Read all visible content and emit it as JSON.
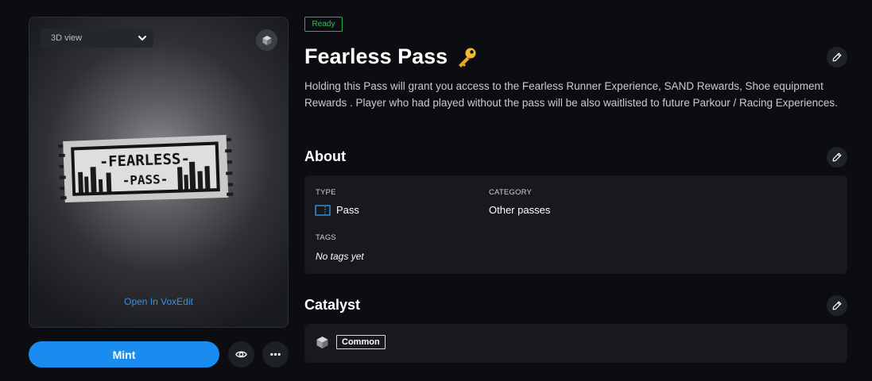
{
  "preview": {
    "view_select": {
      "value": "3D view",
      "icon": "chevron-down-icon"
    },
    "cube_icon": "cube-icon",
    "open_voxedit_label": "Open In VoxEdit",
    "ticket": {
      "line1": "-FEARLESS-",
      "line2": "-PASS-"
    }
  },
  "actions": {
    "mint_label": "Mint",
    "view_icon": "eye-icon",
    "more_icon": "more-icon"
  },
  "asset": {
    "status": "Ready",
    "title": "Fearless Pass",
    "title_icon": "key-icon",
    "description": "Holding this Pass will grant you access to the Fearless Runner Experience, SAND Rewards, Shoe equipment Rewards . Player who had played without the pass will be also waitlisted to future Parkour / Racing Experiences."
  },
  "about": {
    "heading": "About",
    "type_label": "TYPE",
    "type_value": "Pass",
    "category_label": "CATEGORY",
    "category_value": "Other passes",
    "tags_label": "TAGS",
    "tags_value": "No tags yet"
  },
  "catalyst": {
    "heading": "Catalyst",
    "rarity": "Common"
  },
  "colors": {
    "background": "#0b0d11",
    "accent": "#1a8cf0",
    "ready": "#2fc05a",
    "card": "#17191d"
  }
}
